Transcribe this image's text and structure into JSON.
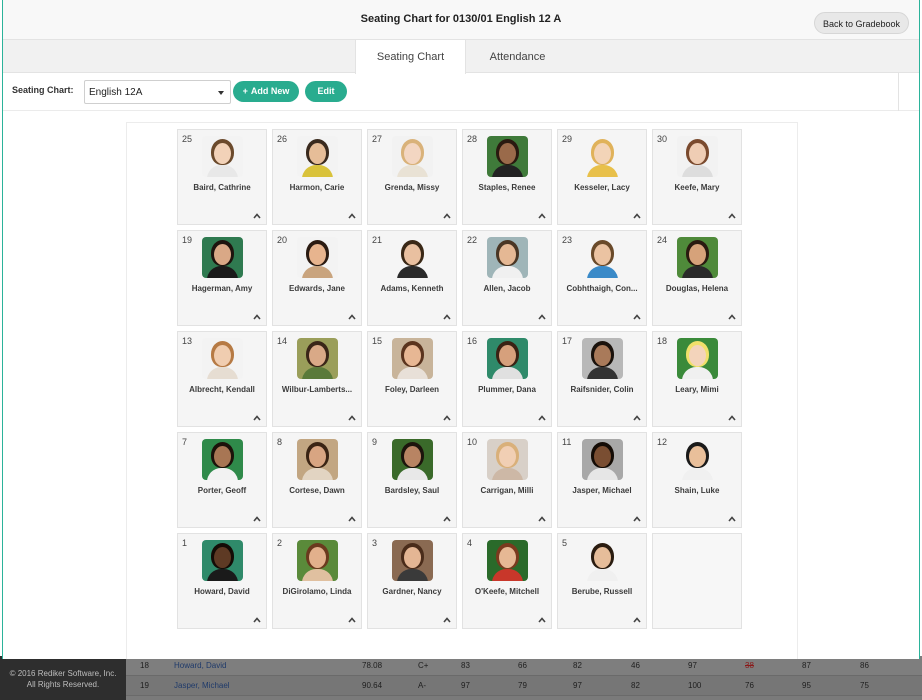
{
  "window": {
    "title": "Seating Chart for 0130/01 English 12 A",
    "back_label": "Back to Gradebook"
  },
  "tabs": [
    {
      "label": "Seating Chart",
      "active": true
    },
    {
      "label": "Attendance",
      "active": false
    }
  ],
  "toolbar": {
    "label": "Seating Chart:",
    "selected_chart": "English 12A",
    "add_label": "Add New",
    "edit_label": "Edit"
  },
  "colors": {
    "accent": "#29ac8f",
    "seat_bg": "#f5f5f5"
  },
  "seats": [
    {
      "num": "25",
      "name": "Baird, Cathrine",
      "skin": "#f2d2b8",
      "hair": "#6b4a2c",
      "bg": "#f3f3f3",
      "shirt": "#e8e8e8"
    },
    {
      "num": "26",
      "name": "Harmon, Carie",
      "skin": "#e6bd98",
      "hair": "#3a2a1e",
      "bg": "#f3f3f3",
      "shirt": "#d9c23a"
    },
    {
      "num": "27",
      "name": "Grenda, Missy",
      "skin": "#f3d6c2",
      "hair": "#d9b27a",
      "bg": "#f2f2f2",
      "shirt": "#e9e2d5"
    },
    {
      "num": "28",
      "name": "Staples, Renee",
      "skin": "#9a6a4a",
      "hair": "#2a1a10",
      "bg": "#3f7a3a",
      "shirt": "#222222"
    },
    {
      "num": "29",
      "name": "Kesseler, Lacy",
      "skin": "#f3d4b8",
      "hair": "#e0b25a",
      "bg": "#f5f5f5",
      "shirt": "#e8c04a"
    },
    {
      "num": "30",
      "name": "Keefe, Mary",
      "skin": "#efcdb4",
      "hair": "#7a4a2e",
      "bg": "#f2f2f2",
      "shirt": "#dddddd"
    },
    {
      "num": "19",
      "name": "Hagerman, Amy",
      "skin": "#d9a886",
      "hair": "#1e140e",
      "bg": "#2f7a50",
      "shirt": "#1a1a1a"
    },
    {
      "num": "20",
      "name": "Edwards, Jane",
      "skin": "#e7b48e",
      "hair": "#2b1b12",
      "bg": "#f3f3f3",
      "shirt": "#c9a47e"
    },
    {
      "num": "21",
      "name": "Adams, Kenneth",
      "skin": "#e9c0a0",
      "hair": "#3a2816",
      "bg": "#f5f5f5",
      "shirt": "#2a2a2a"
    },
    {
      "num": "22",
      "name": "Allen, Jacob",
      "skin": "#e5b894",
      "hair": "#4a3624",
      "bg": "#9fb5b8",
      "shirt": "#f0f0f0"
    },
    {
      "num": "23",
      "name": "Cobhthaigh, Con...",
      "skin": "#ebc3a2",
      "hair": "#6a4a2a",
      "bg": "#f5f5f5",
      "shirt": "#3a8ac8"
    },
    {
      "num": "24",
      "name": "Douglas, Helena",
      "skin": "#d6a27a",
      "hair": "#2a1a10",
      "bg": "#4f8a3a",
      "shirt": "#2a2a2a"
    },
    {
      "num": "13",
      "name": "Albrecht, Kendall",
      "skin": "#f0cdb0",
      "hair": "#b67a44",
      "bg": "#f3f3f3",
      "shirt": "#e6ddd2"
    },
    {
      "num": "14",
      "name": "Wilbur-Lamberts...",
      "skin": "#d9a987",
      "hair": "#3a2618",
      "bg": "#9a9e5a",
      "shirt": "#5a7a3a"
    },
    {
      "num": "15",
      "name": "Foley, Darleen",
      "skin": "#e7b794",
      "hair": "#5a341e",
      "bg": "#c8b49a",
      "shirt": "#e8e0d8"
    },
    {
      "num": "16",
      "name": "Plummer, Dana",
      "skin": "#d6a07c",
      "hair": "#3a2214",
      "bg": "#2f8a6a",
      "shirt": "#e0e0e0"
    },
    {
      "num": "17",
      "name": "Raifsnider, Colin",
      "skin": "#a97a5a",
      "hair": "#1a120c",
      "bg": "#b8b8b8",
      "shirt": "#333333"
    },
    {
      "num": "18",
      "name": "Leary, Mimi",
      "skin": "#f3d4bb",
      "hair": "#f0e06a",
      "bg": "#3a8a3a",
      "shirt": "#f0f0f0"
    },
    {
      "num": "7",
      "name": "Porter, Geoff",
      "skin": "#a87654",
      "hair": "#1c120a",
      "bg": "#2f8a4a",
      "shirt": "#f2f2f2"
    },
    {
      "num": "8",
      "name": "Cortese, Dawn",
      "skin": "#d8a582",
      "hair": "#3a2414",
      "bg": "#c2a682",
      "shirt": "#e2d4c2"
    },
    {
      "num": "9",
      "name": "Bardsley, Saul",
      "skin": "#b88463",
      "hair": "#1c140c",
      "bg": "#3a6a2a",
      "shirt": "#e8e8e8"
    },
    {
      "num": "10",
      "name": "Carrigan, Milli",
      "skin": "#f1cfb4",
      "hair": "#d9b07a",
      "bg": "#d8d0c8",
      "shirt": "#cdb8a6"
    },
    {
      "num": "11",
      "name": "Jasper, Michael",
      "skin": "#7a4e32",
      "hair": "#140c06",
      "bg": "#a8a8a8",
      "shirt": "#e6e6e6"
    },
    {
      "num": "12",
      "name": "Shain, Luke",
      "skin": "#e9bf9a",
      "hair": "#1a1a1a",
      "bg": "#f5f5f5",
      "shirt": "#f0f0f0"
    },
    {
      "num": "1",
      "name": "Howard, David",
      "skin": "#5e3a24",
      "hair": "#140c06",
      "bg": "#2f8a6a",
      "shirt": "#1a1a1a"
    },
    {
      "num": "2",
      "name": "DiGirolamo, Linda",
      "skin": "#e2b08c",
      "hair": "#6a3a1e",
      "bg": "#5a8a3a",
      "shirt": "#e0c0a0"
    },
    {
      "num": "3",
      "name": "Gardner, Nancy",
      "skin": "#e4b694",
      "hair": "#4a2c1a",
      "bg": "#8a6a52",
      "shirt": "#3a3a3a"
    },
    {
      "num": "4",
      "name": "O'Keefe, Mitchell",
      "skin": "#e6b894",
      "hair": "#7a3a1e",
      "bg": "#2a6a2a",
      "shirt": "#c8372a"
    },
    {
      "num": "5",
      "name": "Berube, Russell",
      "skin": "#e6bd9a",
      "hair": "#2a1c10",
      "bg": "#f5f5f5",
      "shirt": "#f0f0f0"
    },
    {
      "num": "",
      "name": "",
      "empty": true
    }
  ],
  "background_gradebook": {
    "footer_lines": [
      "© 2016 Rediker Software, Inc.",
      "All Rights Reserved."
    ],
    "rows": [
      {
        "num": "18",
        "name": "Howard, David",
        "avg": "78.08",
        "grade": "C+",
        "scores": [
          "83",
          "66",
          "82",
          "46",
          "97",
          "38",
          "87",
          "86"
        ]
      },
      {
        "num": "19",
        "name": "Jasper, Michael",
        "avg": "90.64",
        "grade": "A-",
        "scores": [
          "97",
          "79",
          "97",
          "82",
          "100",
          "76",
          "95",
          "75"
        ]
      }
    ]
  }
}
